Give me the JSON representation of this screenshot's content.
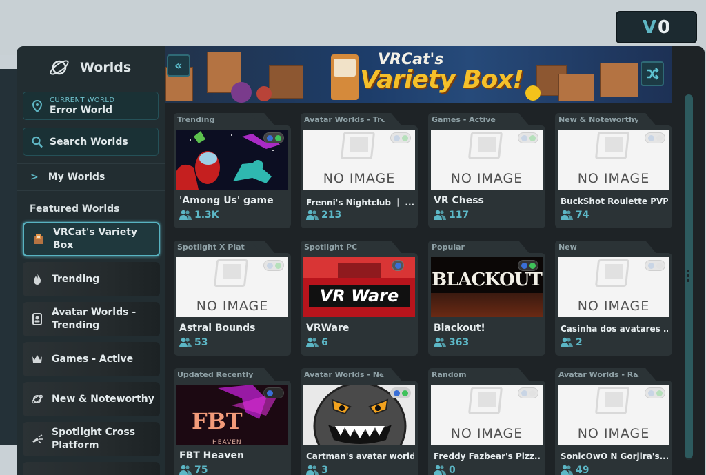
{
  "wallet": {
    "currency_icon": "V",
    "amount": "0"
  },
  "sidebar": {
    "title": "Worlds",
    "current_world": {
      "caption": "CURRENT WORLD",
      "name": "Error World"
    },
    "search_label": "Search Worlds",
    "my_worlds_label": "My Worlds",
    "featured_title": "Featured Worlds",
    "featured_items": [
      {
        "label": "VRCat's Variety Box",
        "icon": "variety-box-icon",
        "selected": true
      },
      {
        "label": "Trending",
        "icon": "flame-icon"
      },
      {
        "label": "Avatar Worlds - Trending",
        "icon": "avatar-icon"
      },
      {
        "label": "Games - Active",
        "icon": "crown-icon"
      },
      {
        "label": "New & Noteworthy",
        "icon": "planet-icon"
      },
      {
        "label": "Spotlight Cross Platform",
        "icon": "spotlight-icon"
      }
    ]
  },
  "banner": {
    "line1": "VRCat's",
    "line2": "Variety Box!"
  },
  "no_image_text": "NO IMAGE",
  "cards": [
    {
      "category": "Trending",
      "name": "'Among Us' game",
      "count": "1.3K"
    },
    {
      "category": "Avatar Worlds - Tre",
      "name": "Frenni's Nightclub ｜ ...",
      "count": "213"
    },
    {
      "category": "Games - Active",
      "name": "VR Chess",
      "count": "117"
    },
    {
      "category": "New & Noteworthy",
      "name": "BuckShot Roulette PVP",
      "count": "74"
    },
    {
      "category": "Spotlight X Plat",
      "name": "Astral Bounds",
      "count": "53"
    },
    {
      "category": "Spotlight PC",
      "name": "VRWare",
      "count": "6",
      "image_text": "VR Ware"
    },
    {
      "category": "Popular",
      "name": "Blackout!",
      "count": "363",
      "image_text": "BLACKOUT"
    },
    {
      "category": "New",
      "name": "Casinha dos avatares ...",
      "count": "2"
    },
    {
      "category": "Updated Recently",
      "name": "FBT Heaven",
      "count": "75",
      "image_text": "FBT",
      "image_subtext": "HEAVEN"
    },
    {
      "category": "Avatar Worlds - New",
      "name": "Cartman's avatar world",
      "count": "3"
    },
    {
      "category": "Random",
      "name": "Freddy Fazbear's Pizz...",
      "count": "0"
    },
    {
      "category": "Avatar Worlds - Ran",
      "name": "SonicOwO N Gorjira's...",
      "count": "49"
    }
  ],
  "colors": {
    "accent": "#5fb6c4",
    "panel": "#1d2629",
    "card": "#2b3336"
  }
}
